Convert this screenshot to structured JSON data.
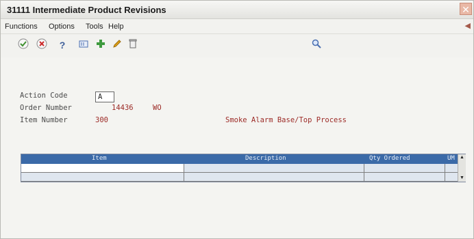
{
  "window": {
    "title": "31111 Intermediate Product Revisions",
    "close_glyph": "✕"
  },
  "menu": {
    "items": [
      "Functions",
      "Options",
      "Tools",
      "Help"
    ]
  },
  "toolbar": {
    "icons": [
      "ok-check-icon",
      "cancel-icon",
      "help-icon",
      "display-icon",
      "add-icon",
      "edit-pencil-icon",
      "delete-icon",
      "search-icon"
    ]
  },
  "form": {
    "action_code_label": "Action Code",
    "action_code_value": "A",
    "order_number_label": "Order Number",
    "order_number_value": "14436",
    "order_type": "WO",
    "item_number_label": "Item Number",
    "item_number_value": "300",
    "item_description": "Smoke Alarm Base/Top Process"
  },
  "grid": {
    "columns": [
      "Item",
      "Description",
      "Qty Ordered",
      "UM"
    ],
    "rows": [
      [
        "",
        "",
        "",
        ""
      ],
      [
        "",
        "",
        "",
        ""
      ],
      [
        "",
        "",
        "",
        ""
      ]
    ]
  },
  "colors": {
    "accent_header": "#3b6aa8",
    "value_text": "#9c2a26"
  }
}
